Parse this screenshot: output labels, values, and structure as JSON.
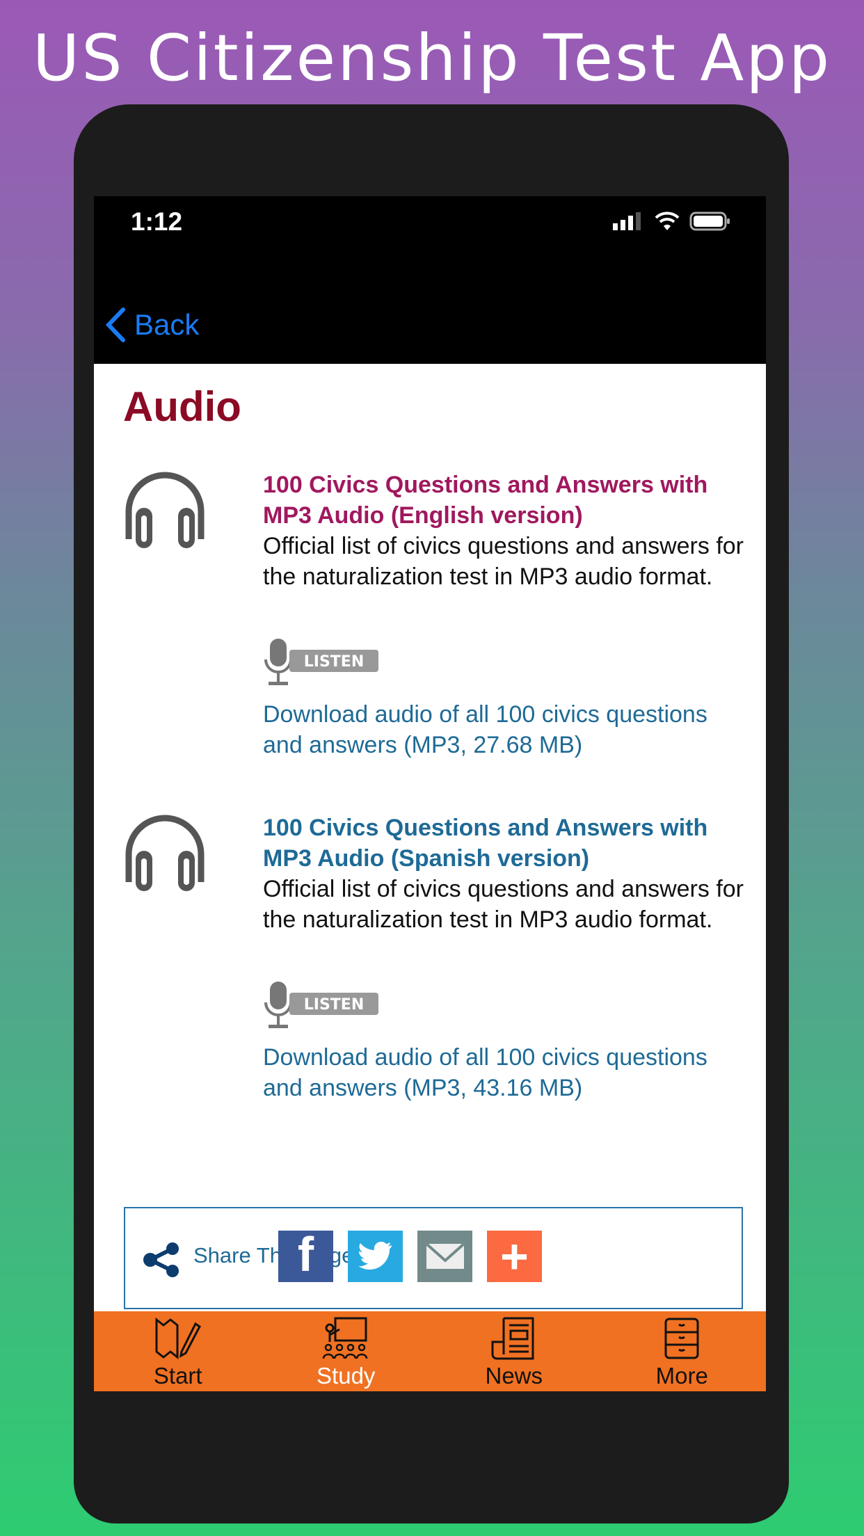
{
  "promo_title": "US Citizenship Test App",
  "status_bar": {
    "time": "1:12"
  },
  "nav": {
    "back_label": "Back"
  },
  "page_title": "Audio",
  "items": [
    {
      "title": "100 Civics Questions and Answers with MP3 Audio (English version)",
      "title_color": "#a0185e",
      "description": "Official list of civics questions and answers for the naturalization test in MP3 audio format.",
      "listen_label": "LISTEN",
      "download_link": "Download audio of all 100 civics questions and answers (MP3, 27.68 MB)"
    },
    {
      "title": "100 Civics Questions and Answers with MP3 Audio (Spanish version)",
      "title_color": "#1e6a96",
      "description": "Official list of civics questions and answers for the naturalization test in MP3 audio format.",
      "listen_label": "LISTEN",
      "download_link": "Download audio of all 100 civics questions and answers (MP3, 43.16 MB)"
    }
  ],
  "share": {
    "label": "Share This Page",
    "buttons": [
      {
        "icon": "facebook-icon",
        "glyph": "f",
        "color": "#3b5998"
      },
      {
        "icon": "twitter-icon",
        "color": "#28aae1"
      },
      {
        "icon": "email-icon",
        "color": "#728a8a"
      },
      {
        "icon": "plus-icon",
        "glyph": "+",
        "color": "#fb6a40"
      }
    ]
  },
  "tabs": [
    {
      "label": "Start",
      "icon": "map-pencil-icon"
    },
    {
      "label": "Study",
      "icon": "classroom-icon",
      "active": true
    },
    {
      "label": "News",
      "icon": "newspaper-icon"
    },
    {
      "label": "More",
      "icon": "cabinet-icon"
    }
  ],
  "colors": {
    "tab_bar": "#f07122",
    "title": "#8b0a24",
    "link": "#1e6a96",
    "back": "#1a7cf5"
  }
}
